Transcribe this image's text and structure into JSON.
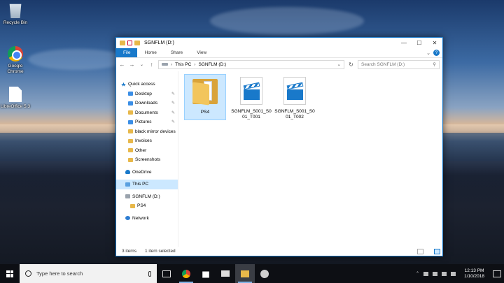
{
  "desktop": {
    "icons": [
      {
        "label": "Recycle Bin"
      },
      {
        "label": "Google Chrome"
      },
      {
        "label": "LibreOffice 5.3"
      }
    ]
  },
  "window": {
    "title": "SGNFLM (D:)",
    "controls": {
      "minimize": "—",
      "maximize": "☐",
      "close": "✕"
    },
    "ribbon": {
      "tabs": [
        "File",
        "Home",
        "Share",
        "View"
      ],
      "expand": "⌄",
      "help": "?"
    },
    "nav": {
      "back": "←",
      "forward": "→",
      "recent": "⌄",
      "up": "↑",
      "breadcrumb": [
        "This PC",
        "SGNFLM (D:)"
      ],
      "dropdown": "⌄",
      "refresh": "↻",
      "search_placeholder": "Search SGNFLM (D:)",
      "search_icon": "⚲"
    },
    "navpane": {
      "quick_access": "Quick access",
      "quick_items": [
        {
          "label": "Desktop",
          "pinned": true
        },
        {
          "label": "Downloads",
          "pinned": true
        },
        {
          "label": "Documents",
          "pinned": true
        },
        {
          "label": "Pictures",
          "pinned": true
        },
        {
          "label": "black mirror devices",
          "pinned": false
        },
        {
          "label": "Invoices",
          "pinned": false
        },
        {
          "label": "Other",
          "pinned": false
        },
        {
          "label": "Screenshots",
          "pinned": false
        }
      ],
      "onedrive": "OneDrive",
      "this_pc": "This PC",
      "drive": "SGNFLM (D:)",
      "drive_folder": "PS4",
      "network": "Network",
      "pin_glyph": "✎"
    },
    "files": [
      {
        "name": "PS4",
        "type": "folder",
        "selected": true
      },
      {
        "name": "SGNFLM_S001_S001_T001",
        "type": "video",
        "selected": false
      },
      {
        "name": "SGNFLM_S001_S001_T002",
        "type": "video",
        "selected": false
      }
    ],
    "status": {
      "count": "3 items",
      "selection": "1 item selected"
    }
  },
  "taskbar": {
    "search_placeholder": "Type here to search",
    "time": "12:13 PM",
    "date": "1/10/2018"
  },
  "colors": {
    "accent": "#1979ca",
    "selection": "#cce8ff",
    "folder": "#e8b84a"
  }
}
